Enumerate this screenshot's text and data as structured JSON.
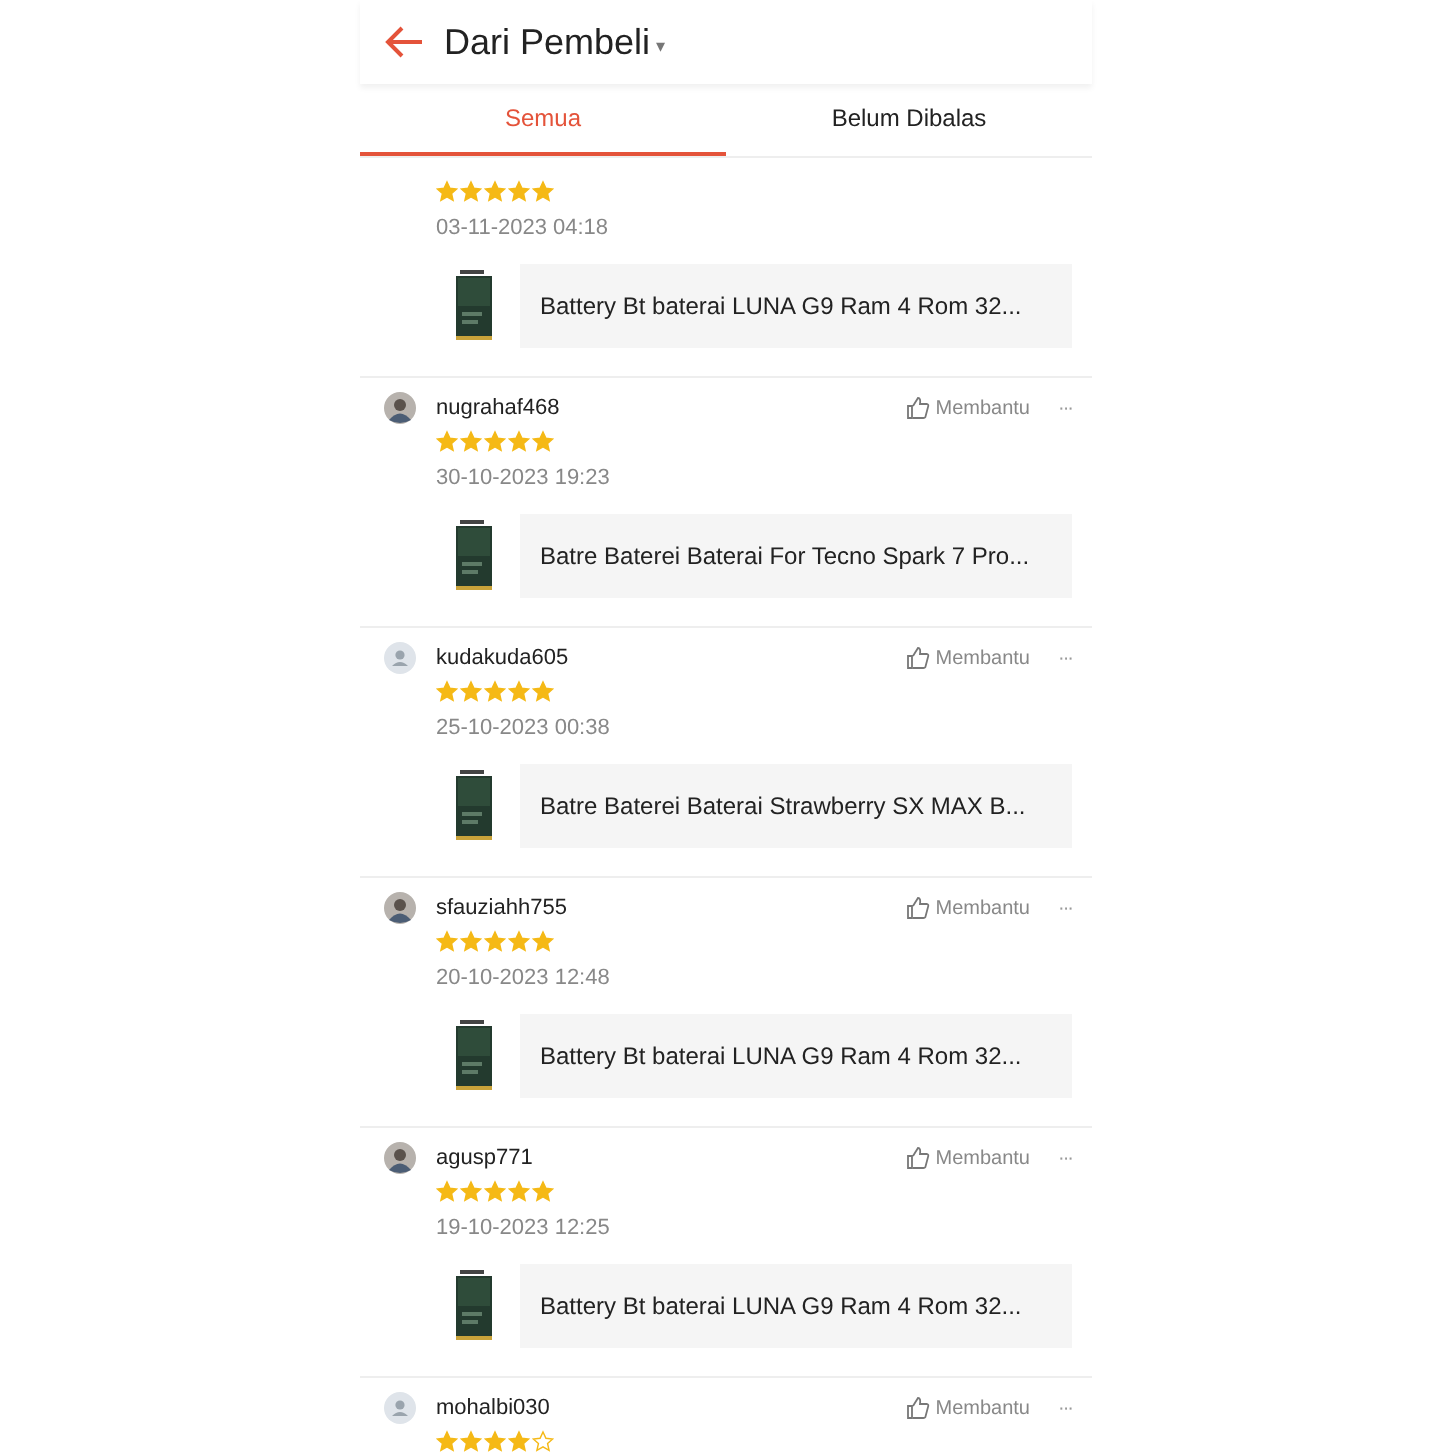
{
  "header": {
    "title": "Dari Pembeli",
    "caret": "▾"
  },
  "tabs": [
    {
      "label": "Semua",
      "selected": true
    },
    {
      "label": "Belum Dibalas",
      "selected": false
    }
  ],
  "reviews": [
    {
      "stars": 5,
      "date": "03-11-2023 04:18",
      "product": "Battery Bt baterai LUNA G9  Ram 4 Rom 32..."
    },
    {
      "user": "nugrahaf468",
      "helpful": "Membantu",
      "more": "···",
      "stars": 5,
      "date": "30-10-2023 19:23",
      "product": "Batre Baterei Baterai For Tecno Spark 7 Pro..."
    },
    {
      "user": "kudakuda605",
      "avatar": {
        "kind": "default"
      },
      "helpful": "Membantu",
      "more": "···",
      "stars": 5,
      "date": "25-10-2023 00:38",
      "product": "Batre Baterei Baterai Strawberry SX MAX B..."
    },
    {
      "user": "sfauziahh755",
      "helpful": "Membantu",
      "more": "···",
      "stars": 5,
      "date": "20-10-2023 12:48",
      "product": "Battery Bt baterai LUNA G9  Ram 4 Rom 32..."
    },
    {
      "user": "agusp771",
      "helpful": "Membantu",
      "more": "···",
      "stars": 5,
      "date": "19-10-2023 12:25",
      "product": "Battery Bt baterai LUNA G9  Ram 4 Rom 32..."
    },
    {
      "user": "mohalbi030",
      "avatar": {
        "kind": "default"
      },
      "helpful": "Membantu",
      "more": "···",
      "stars": 4
    }
  ]
}
